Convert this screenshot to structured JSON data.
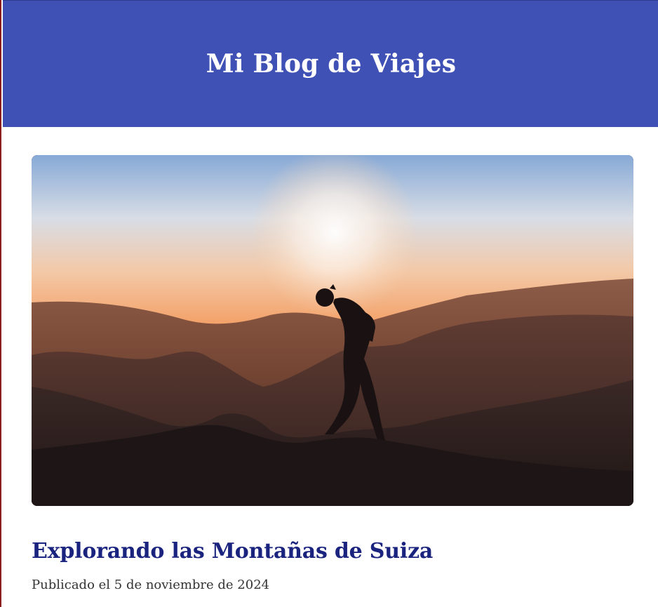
{
  "site": {
    "title": "Mi Blog de Viajes"
  },
  "post": {
    "title": "Explorando las Montañas de Suiza",
    "meta": "Publicado el 5 de noviembre de 2024",
    "image": {
      "subject": "silhouette-hiker-mountains-sunset"
    }
  },
  "colors": {
    "header_bg": "#3f51b5",
    "header_text": "#ffffff",
    "post_title": "#1a237e",
    "post_meta": "#333333"
  }
}
